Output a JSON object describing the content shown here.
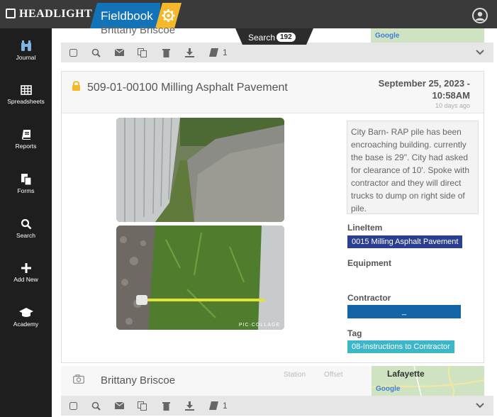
{
  "header": {
    "logo_text": "HEADLIGHT",
    "app_title": "Fieldbook",
    "search_label": "Search",
    "search_count": "192",
    "colors": {
      "topbar": "#3a3a3a",
      "accent_blue": "#1273b8",
      "accent_yellow": "#f5b82b"
    }
  },
  "sidebar": {
    "items": [
      {
        "label": "Journal",
        "icon": "binoculars-icon"
      },
      {
        "label": "Spreadsheets",
        "icon": "grid-icon"
      },
      {
        "label": "Reports",
        "icon": "book-icon"
      },
      {
        "label": "Forms",
        "icon": "forms-icon"
      },
      {
        "label": "Search",
        "icon": "search-icon"
      },
      {
        "label": "Add New",
        "icon": "plus-icon"
      },
      {
        "label": "Academy",
        "icon": "graduation-cap-icon"
      }
    ]
  },
  "prev_entry": {
    "name": "Brittany Briscoe",
    "map_label": "Google",
    "toolbar": {
      "attachment_count": "1"
    }
  },
  "entry": {
    "title": "509-01-00100 Milling Asphalt Pavement",
    "date_line1": "September 25, 2023 -",
    "date_line2": "10:58AM",
    "relative_time": "10 days ago",
    "photo_watermark": "PIC·COLLAGE",
    "notes": "City Barn- RAP pile has been encroaching building. currently the base is 29\". City had asked for clearance of 10'. Spoke with contractor and they will direct trucks to dump on right side of pile.",
    "lineitem_label": "LineItem",
    "lineitem_value": "0015 Milling Asphalt Pavement",
    "equipment_label": "Equipment",
    "contractor_label": "Contractor",
    "contractor_value": "_",
    "tag_label": "Tag",
    "tag_value": "08-Instructions to Contractor",
    "colors": {
      "lineitem_chip": "#2a3f8f",
      "contractor_chip": "#1464a8",
      "tag_chip": "#3bb7c9",
      "lock": "#f5b82b"
    }
  },
  "next_entry": {
    "name": "Brittany Briscoe",
    "station_label": "Station",
    "offset_label": "Offset",
    "map_town": "Lafayette",
    "map_label": "Google",
    "toolbar": {
      "attachment_count": "1"
    }
  }
}
